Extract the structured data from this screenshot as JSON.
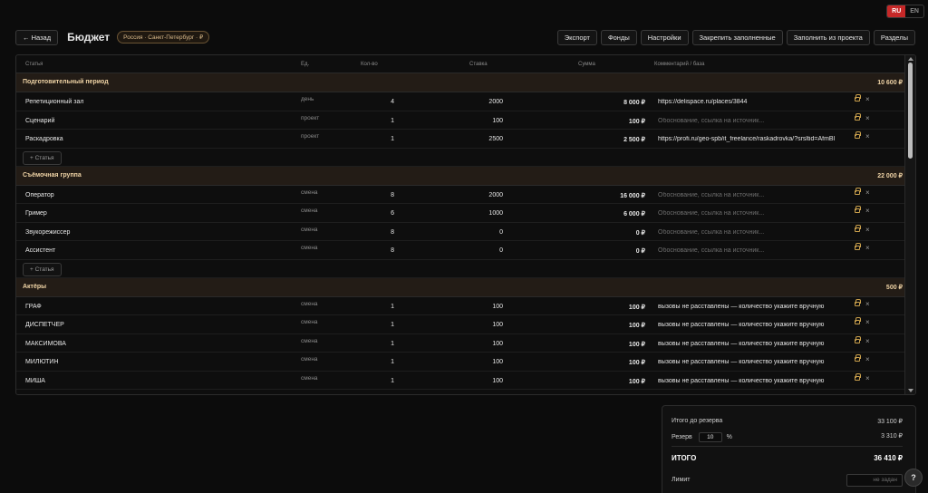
{
  "lang": {
    "ru": "RU",
    "en": "EN",
    "active": "RU"
  },
  "header": {
    "back_label": "← Назад",
    "title": "Бюджет",
    "region": "Россия · Санкт-Петербург · ₽",
    "toolbar": [
      "Экспорт",
      "Фонды",
      "Настройки",
      "Закрепить заполненные",
      "Заполнить из проекта",
      "Разделы"
    ]
  },
  "columns": [
    "Статья",
    "Ед.",
    "Кол-во",
    "Ставка",
    "Сумма",
    "Комментарий / база"
  ],
  "sections": [
    {
      "name": "Подготовительный период",
      "total": "10 600 ₽",
      "add_label": "+ Статья",
      "rows": [
        {
          "name": "Репетиционный зал",
          "unit": "день",
          "qty": "4",
          "rate": "2000",
          "sum": "8 000 ₽",
          "comment": "https://delispace.ru/places/3844",
          "placeholder": false
        },
        {
          "name": "Сценарий",
          "unit": "проект",
          "qty": "1",
          "rate": "100",
          "sum": "100 ₽",
          "comment": "Обоснование, ссылка на источник...",
          "placeholder": true
        },
        {
          "name": "Раскадровка",
          "unit": "проект",
          "qty": "1",
          "rate": "2500",
          "sum": "2 500 ₽",
          "comment": "https://profi.ru/geo-spb/it_freelance/raskadrovka/?srsltid=AfmBl",
          "placeholder": false
        }
      ]
    },
    {
      "name": "Съёмочная группа",
      "total": "22 000 ₽",
      "add_label": "+ Статья",
      "rows": [
        {
          "name": "Оператор",
          "unit": "смена",
          "qty": "8",
          "rate": "2000",
          "sum": "16 000 ₽",
          "comment": "Обоснование, ссылка на источник...",
          "placeholder": true
        },
        {
          "name": "Гример",
          "unit": "смена",
          "qty": "6",
          "rate": "1000",
          "sum": "6 000 ₽",
          "comment": "Обоснование, ссылка на источник...",
          "placeholder": true
        },
        {
          "name": "Звукорежиссер",
          "unit": "смена",
          "qty": "8",
          "rate": "0",
          "sum": "0 ₽",
          "comment": "Обоснование, ссылка на источник...",
          "placeholder": true
        },
        {
          "name": "Ассистент",
          "unit": "смена",
          "qty": "8",
          "rate": "0",
          "sum": "0 ₽",
          "comment": "Обоснование, ссылка на источник...",
          "placeholder": true
        }
      ]
    },
    {
      "name": "Актёры",
      "total": "500 ₽",
      "add_label": "",
      "rows": [
        {
          "name": "ГРАФ",
          "unit": "смена",
          "qty": "1",
          "rate": "100",
          "sum": "100 ₽",
          "comment": "вызовы не расставлены — количество укажите вручную",
          "placeholder": false
        },
        {
          "name": "ДИСПЕТЧЕР",
          "unit": "смена",
          "qty": "1",
          "rate": "100",
          "sum": "100 ₽",
          "comment": "вызовы не расставлены — количество укажите вручную",
          "placeholder": false
        },
        {
          "name": "МАКСИМОВА",
          "unit": "смена",
          "qty": "1",
          "rate": "100",
          "sum": "100 ₽",
          "comment": "вызовы не расставлены — количество укажите вручную",
          "placeholder": false
        },
        {
          "name": "МИЛЮТИН",
          "unit": "смена",
          "qty": "1",
          "rate": "100",
          "sum": "100 ₽",
          "comment": "вызовы не расставлены — количество укажите вручную",
          "placeholder": false
        },
        {
          "name": "МИША",
          "unit": "смена",
          "qty": "1",
          "rate": "100",
          "sum": "100 ₽",
          "comment": "вызовы не расставлены — количество укажите вручную",
          "placeholder": false
        }
      ]
    }
  ],
  "row_icons": {
    "lock": "lock-icon",
    "remove": "×"
  },
  "summary": {
    "pre_reserve_label": "Итого до резерва",
    "pre_reserve_value": "33 100 ₽",
    "reserve_label": "Резерв",
    "reserve_percent": "10",
    "percent_sign": "%",
    "reserve_value": "3 310 ₽",
    "total_label": "ИТОГО",
    "total_value": "36 410 ₽",
    "limit_label": "Лимит",
    "limit_placeholder": "не задан"
  },
  "help_label": "?",
  "colors": {
    "accent": "#c62828",
    "section_bg": "#231c16",
    "section_text": "#f0d4a6",
    "lock": "#caa04c"
  }
}
